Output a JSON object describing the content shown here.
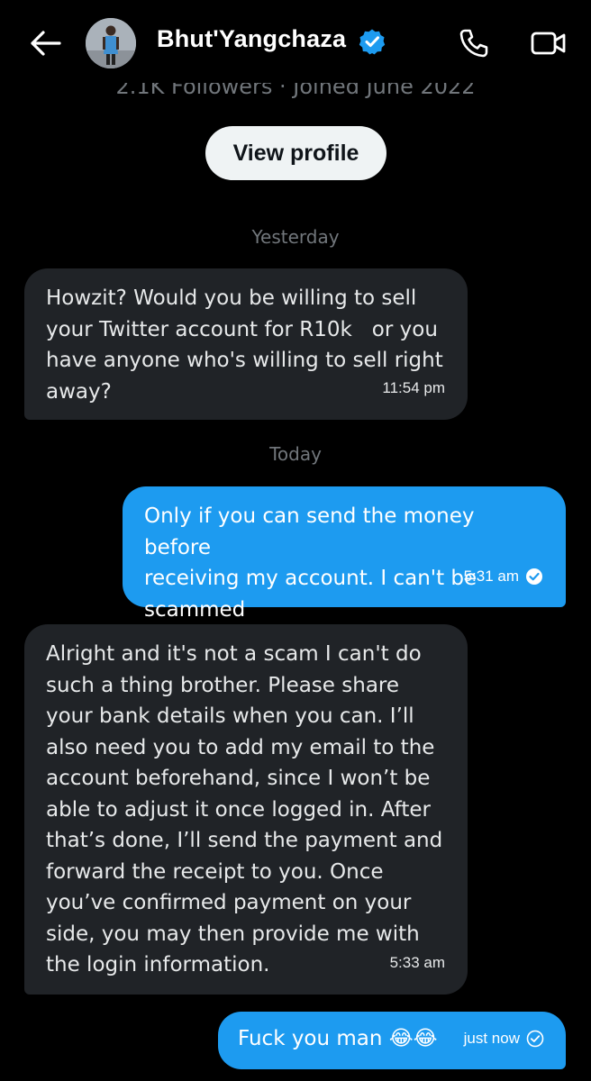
{
  "header": {
    "contact_name": "Bhut'Yangchaza",
    "back_icon": "arrow-left-icon",
    "verified_icon": "verified-badge-icon",
    "call_icon": "phone-icon",
    "video_icon": "video-camera-icon"
  },
  "profile": {
    "followers_line": "2.1K Followers · Joined June 2022",
    "view_profile_label": "View profile"
  },
  "conversation": {
    "separators": [
      "Yesterday",
      "Today"
    ],
    "messages": [
      {
        "direction": "incoming",
        "text": "Howzit? Would you be willing to sell\nyour Twitter account for R10k   or you\nhave anyone who's willing to sell right\naway?",
        "time": "11:54 pm"
      },
      {
        "direction": "outgoing",
        "text": "Only if you can send the money before\nreceiving my account. I can't be\nscammed",
        "time": "5:31 am",
        "status": "seen"
      },
      {
        "direction": "incoming",
        "text": "Alright and it's not a scam I can't do\nsuch a thing brother. Please share\nyour bank details when you can. I’ll\nalso need you to add my email to the\naccount beforehand, since I won’t be\nable to adjust it once logged in. After\nthat’s done, I’ll send the payment and\nforward the receipt to you. Once\nyou’ve confirmed payment on your\nside, you may then provide me with\nthe login information.",
        "time": "5:33 am"
      },
      {
        "direction": "outgoing",
        "text": "Fuck you man 😂😂",
        "time": "just now",
        "status": "sent"
      }
    ]
  },
  "colors": {
    "background": "#000000",
    "incoming_bubble": "#202327",
    "outgoing_bubble": "#1d9bf0",
    "verified_blue": "#1d9bf0",
    "muted_text": "#71767b"
  }
}
